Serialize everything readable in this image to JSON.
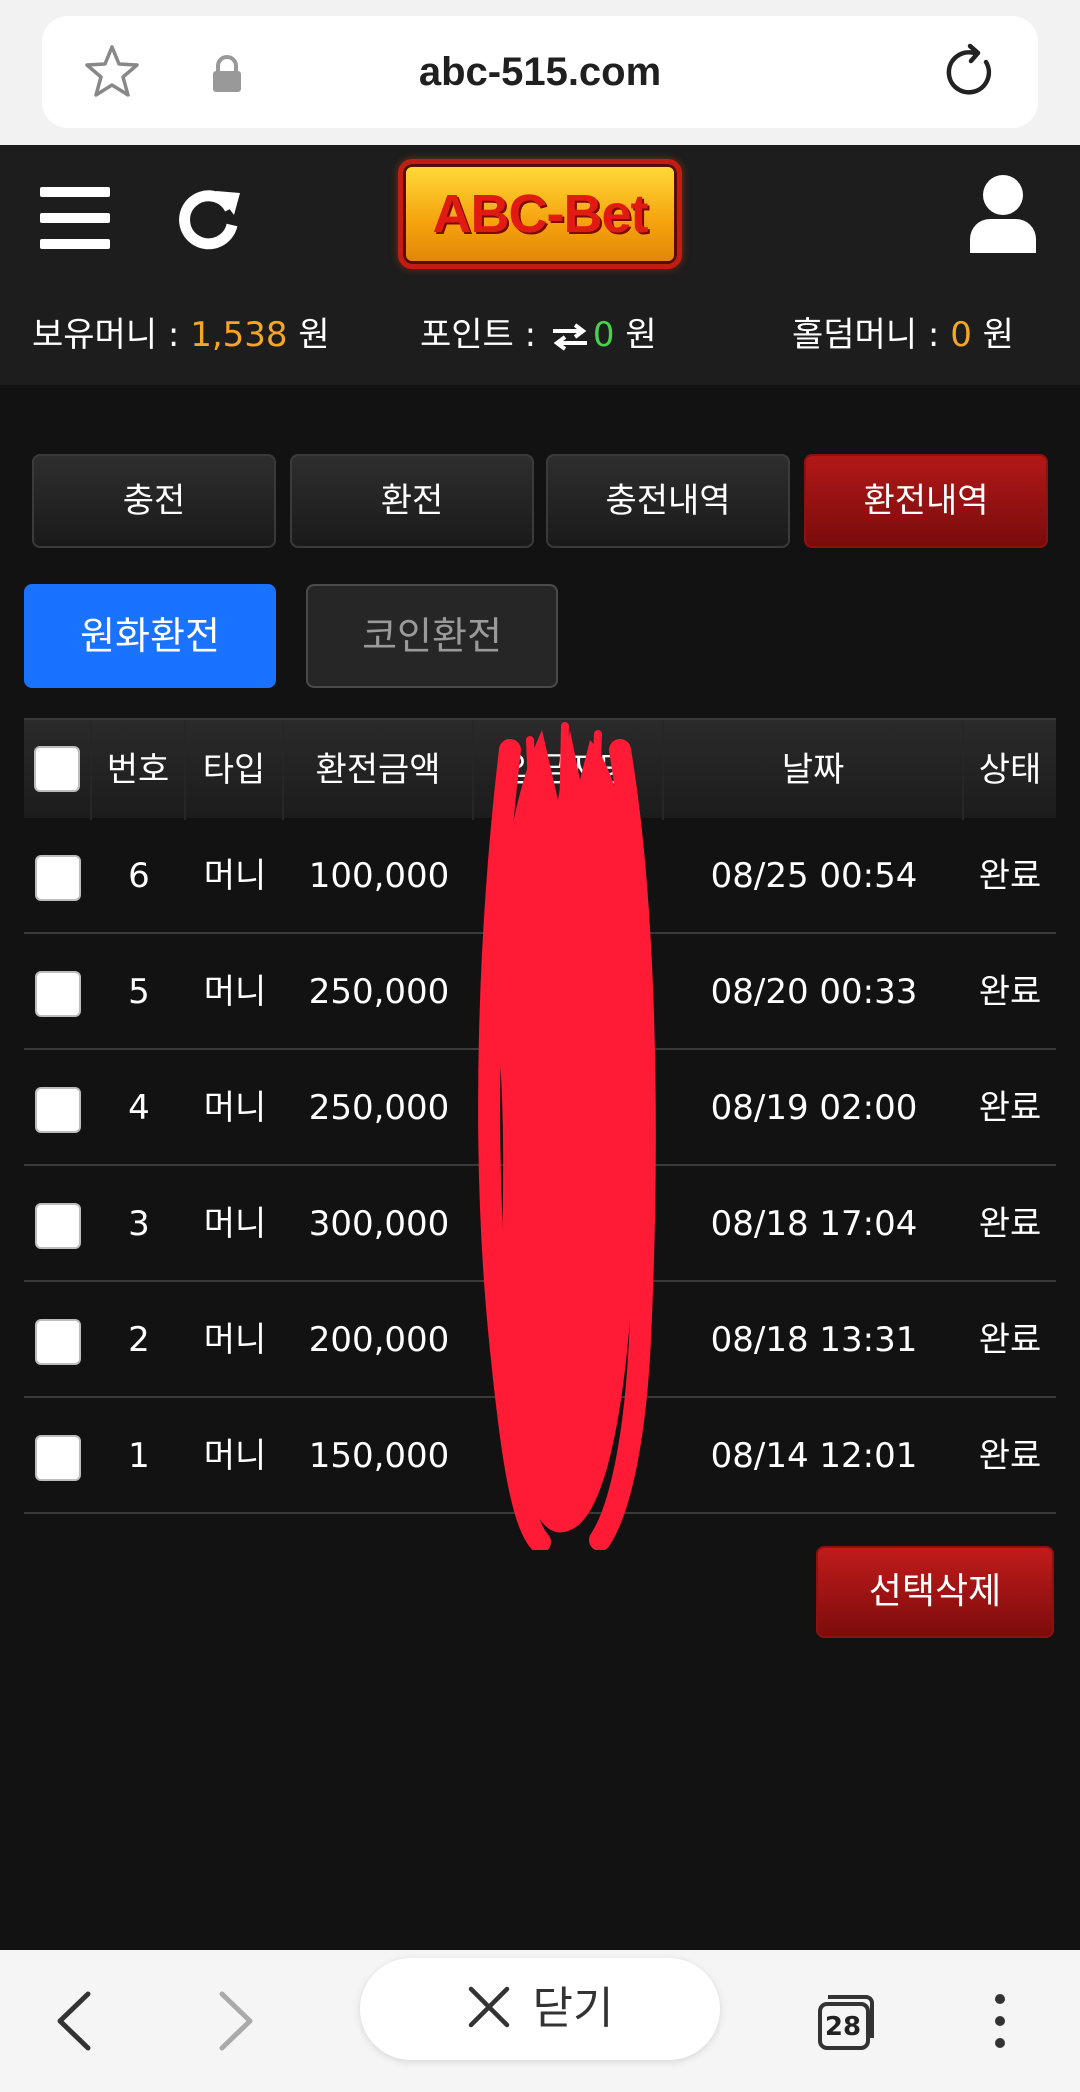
{
  "browser": {
    "url": "abc-515.com",
    "close_label": "닫기",
    "tab_count": "28"
  },
  "header": {
    "logo_text": "ABC-Bet",
    "balances": {
      "money_label": "보유머니 : ",
      "money_value": "1,538",
      "money_unit": " 원",
      "point_label": "포인트 : ",
      "point_value": "0",
      "point_unit": " 원",
      "holdem_label": "홀덤머니 : ",
      "holdem_value": "0",
      "holdem_unit": " 원"
    }
  },
  "tabs": [
    {
      "label": "충전",
      "active": false
    },
    {
      "label": "환전",
      "active": false
    },
    {
      "label": "충전내역",
      "active": false
    },
    {
      "label": "환전내역",
      "active": true
    }
  ],
  "subtabs": [
    {
      "label": "원화환전",
      "active": true
    },
    {
      "label": "코인환전",
      "active": false
    }
  ],
  "table": {
    "headers": {
      "num": "번호",
      "type": "타입",
      "amount": "환전금액",
      "name": "입금자명",
      "date": "날짜",
      "status": "상태"
    },
    "rows": [
      {
        "num": "6",
        "type": "머니",
        "amount": "100,000",
        "name": "",
        "date": "08/25 00:54",
        "status": "완료"
      },
      {
        "num": "5",
        "type": "머니",
        "amount": "250,000",
        "name": "",
        "date": "08/20 00:33",
        "status": "완료"
      },
      {
        "num": "4",
        "type": "머니",
        "amount": "250,000",
        "name": "",
        "date": "08/19 02:00",
        "status": "완료"
      },
      {
        "num": "3",
        "type": "머니",
        "amount": "300,000",
        "name": "",
        "date": "08/18 17:04",
        "status": "완료"
      },
      {
        "num": "2",
        "type": "머니",
        "amount": "200,000",
        "name": "",
        "date": "08/18 13:31",
        "status": "완료"
      },
      {
        "num": "1",
        "type": "머니",
        "amount": "150,000",
        "name": "",
        "date": "08/14 12:01",
        "status": "완료"
      }
    ]
  },
  "actions": {
    "delete_label": "선택삭제"
  },
  "colors": {
    "accent_red": "#b21818",
    "accent_blue": "#1a73ff",
    "money_orange": "#f5a623",
    "point_green": "#46d24a",
    "redaction": "#ff1a35"
  },
  "icons": {
    "bookmark": "star-icon",
    "secure": "lock-icon",
    "reload": "reload-icon",
    "menu": "hamburger-icon",
    "refresh": "refresh-icon",
    "account": "user-icon",
    "points": "swap-icon",
    "back": "chevron-left-icon",
    "forward": "chevron-right-icon",
    "close": "close-icon",
    "tabs": "tabs-icon",
    "more": "more-vertical-icon"
  }
}
